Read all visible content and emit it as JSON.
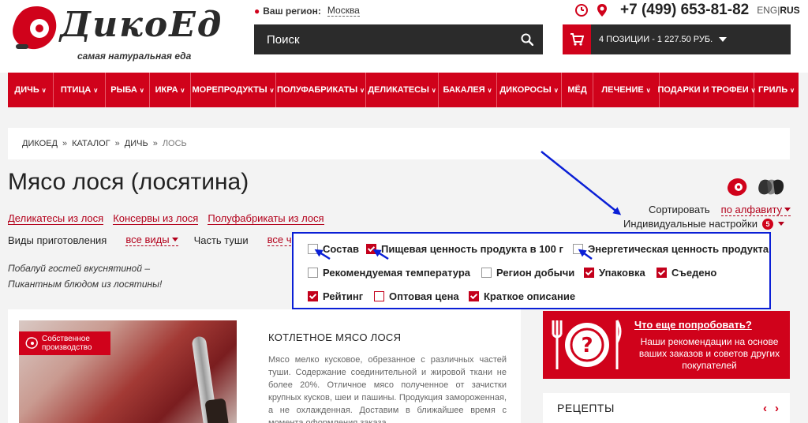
{
  "brand": {
    "logo_text": "ДикоЕд",
    "tagline": "самая натуральная еда"
  },
  "header": {
    "region_label": "Ваш регион:",
    "region_city": "Москва",
    "search_placeholder": "Поиск",
    "phone": "+7 (499) 653-81-82",
    "lang_en": "ENG",
    "lang_sep": "|",
    "lang_ru": "RUS",
    "cart_text": "4 ПОЗИЦИИ - 1 227.50 РУБ."
  },
  "nav": {
    "items": [
      {
        "label": "ДИЧЬ",
        "chev": "∨"
      },
      {
        "label": "ПТИЦА",
        "chev": "∨"
      },
      {
        "label": "РЫБА",
        "chev": "∨"
      },
      {
        "label": "ИКРА",
        "chev": "∨"
      },
      {
        "label": "МОРЕПРОДУКТЫ",
        "chev": "∨"
      },
      {
        "label": "ПОЛУФАБРИКАТЫ",
        "chev": "∨"
      },
      {
        "label": "ДЕЛИКАТЕСЫ",
        "chev": "∨"
      },
      {
        "label": "БАКАЛЕЯ",
        "chev": "∨"
      },
      {
        "label": "ДИКОРОСЫ",
        "chev": "∨"
      },
      {
        "label": "МЁД",
        "chev": ""
      },
      {
        "label": "ЛЕЧЕНИЕ",
        "chev": "∨"
      },
      {
        "label": "ПОДАРКИ И ТРОФЕИ",
        "chev": "∨"
      },
      {
        "label": "ГРИЛЬ",
        "chev": "∨"
      }
    ]
  },
  "breadcrumb": {
    "items": [
      "ДИКОЕД",
      "КАТАЛОГ",
      "ДИЧЬ"
    ],
    "sep": "»",
    "current": "ЛОСЬ"
  },
  "page": {
    "title": "Мясо лося (лосятина)",
    "sublinks": [
      "Деликатесы из лося",
      "Консервы из лося",
      "Полуфабрикаты из лося"
    ],
    "sort_label": "Сортировать",
    "sort_value": "по алфавиту",
    "individual_label": "Индивидуальные настройки",
    "individual_count": "5",
    "filter_cooking_label": "Виды приготовления",
    "filter_cooking_value": "все виды",
    "filter_part_label": "Часть туши",
    "filter_part_value": "все ч",
    "slogan_line1": "Побалуй гостей вкуснятиной –",
    "slogan_line2": "Пикантным блюдом из лосятины!"
  },
  "settings": {
    "options": [
      {
        "label": "Состав",
        "checked": false
      },
      {
        "label": "Пищевая ценность продукта в 100 г",
        "checked": true
      },
      {
        "label": "Энергетическая ценность продукта",
        "checked": false
      },
      {
        "label": "Рекомендуемая температура",
        "checked": false
      },
      {
        "label": "Регион добычи",
        "checked": false
      },
      {
        "label": "Упаковка",
        "checked": true
      },
      {
        "label": "Съедено",
        "checked": true
      },
      {
        "label": "Рейтинг",
        "checked": true
      },
      {
        "label": "Оптовая цена",
        "checked": false
      },
      {
        "label": "Краткое описание",
        "checked": true
      }
    ]
  },
  "product": {
    "badge": "Собственное производство",
    "badge_line1": "Собственное",
    "badge_line2": "производство",
    "name": "КОТЛЕТНОЕ МЯСО ЛОСЯ",
    "description": "Мясо мелко кусковое, обрезанное с различных частей туши. Содержание соединительной и жировой ткани не более 20%. Отличное мясо полученное от зачистки крупных кусков, шеи и пашины. Продукция замороженная, а не охлажденная. Доставим в ближайшее время с момента оформления заказа."
  },
  "promo": {
    "title": "Что еще попробовать?",
    "text": "Наши рекомендации на основе ваших заказов и советов других покупателей"
  },
  "recipes": {
    "title": "РЕЦЕПТЫ",
    "prev": "‹",
    "next": "›"
  },
  "colors": {
    "brand_red": "#d0021b",
    "dark_bar": "#2b2b2b",
    "annotation_blue": "#0a1fd6"
  }
}
